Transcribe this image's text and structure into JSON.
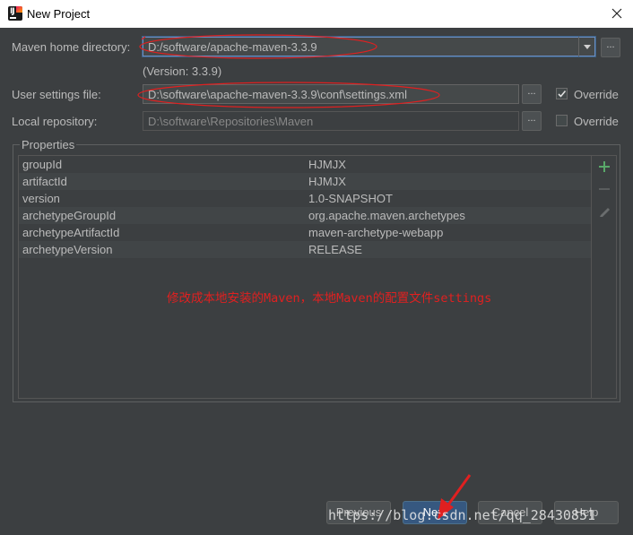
{
  "window": {
    "title": "New Project"
  },
  "maven_home": {
    "label": "Maven home directory:",
    "value": "D:/software/apache-maven-3.3.9",
    "version": "(Version: 3.3.9)"
  },
  "user_settings": {
    "label": "User settings file:",
    "value": "D:\\software\\apache-maven-3.3.9\\conf\\settings.xml",
    "override_label": "Override",
    "override_checked": true
  },
  "local_repo": {
    "label": "Local repository:",
    "value": "D:\\software\\Repositories\\Maven",
    "override_label": "Override",
    "override_checked": false
  },
  "properties": {
    "title": "Properties",
    "rows": [
      {
        "key": "groupId",
        "value": "HJMJX"
      },
      {
        "key": "artifactId",
        "value": "HJMJX"
      },
      {
        "key": "version",
        "value": "1.0-SNAPSHOT"
      },
      {
        "key": "archetypeGroupId",
        "value": "org.apache.maven.archetypes"
      },
      {
        "key": "archetypeArtifactId",
        "value": "maven-archetype-webapp"
      },
      {
        "key": "archetypeVersion",
        "value": "RELEASE"
      }
    ]
  },
  "annotation": "修改成本地安装的Maven，本地Maven的配置文件settings",
  "buttons": {
    "previous": "Previous",
    "next": "Next",
    "cancel": "Cancel",
    "help": "Help",
    "browse": "..."
  },
  "watermark": "https://blog.csdn.net/qq_28430851",
  "icons": {
    "add": "plus-icon",
    "remove": "minus-icon",
    "edit": "pencil-icon",
    "close": "close-icon",
    "app": "intellij-idea-icon"
  },
  "colors": {
    "background": "#3c3f41",
    "annotation": "#e02020",
    "add_icon": "#59a869",
    "primary_button": "#365880"
  }
}
